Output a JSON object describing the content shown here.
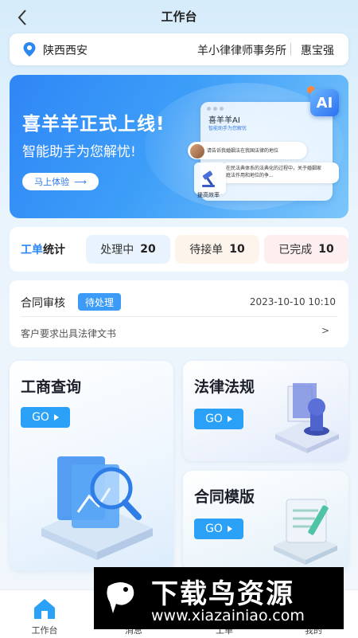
{
  "header": {
    "title": "工作台",
    "back_icon": "chevron-left-icon"
  },
  "location_bar": {
    "location": "陕西西安",
    "firm": "羊小律律师事务所",
    "user": "惠宝强",
    "pin_icon": "location-pin-icon",
    "accent": "#2d87f0"
  },
  "banner": {
    "title": "喜羊羊正式上线!",
    "subtitle": "智能助手为您解忧!",
    "button": "马上体验",
    "assistant_name": "喜羊羊AI",
    "assistant_tag": "智能助手为您解忧",
    "question": "请告诉我婚姻法在我国法律的地位",
    "answer": "在民法典体系的法典化的过程中，关于婚姻家庭法作用和地位的争...",
    "efficiency": "提高效率",
    "ai_badge": "AI"
  },
  "stats": {
    "label_highlight": "工单",
    "label_rest": "统计",
    "items": [
      {
        "label": "处理中",
        "count": "20"
      },
      {
        "label": "待接单",
        "count": "10"
      },
      {
        "label": "已完成",
        "count": "10"
      }
    ]
  },
  "review": {
    "title": "合同审核",
    "badge": "待处理",
    "datetime": "2023-10-10 10:10",
    "description": "客户要求出具法律文书",
    "arrow": ">"
  },
  "features": [
    {
      "title": "工商查询",
      "go": "GO"
    },
    {
      "title": "法律法规",
      "go": "GO"
    },
    {
      "title": "合同模版",
      "go": "GO"
    }
  ],
  "tabs": [
    {
      "label": "工作台",
      "icon": "home-icon",
      "active": true
    },
    {
      "label": "消息",
      "icon": "message-icon",
      "active": false
    },
    {
      "label": "工单",
      "icon": "ticket-icon",
      "active": false
    },
    {
      "label": "我的",
      "icon": "profile-icon",
      "active": false
    }
  ],
  "watermark": {
    "title": "下载鸟资源",
    "url": "www.xiazainiao.com"
  }
}
